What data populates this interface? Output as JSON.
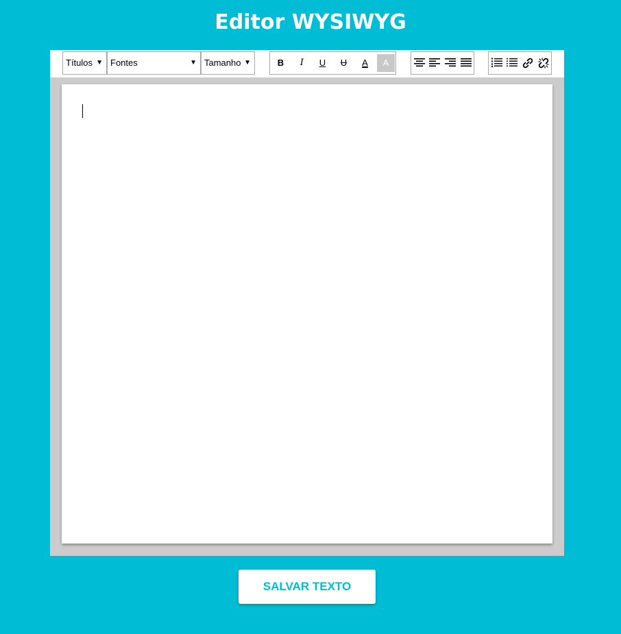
{
  "app": {
    "title": "Editor WYSIWYG"
  },
  "toolbar": {
    "headings_select": "Títulos",
    "fonts_select": "Fontes",
    "size_select": "Tamanho",
    "bold_label": "B",
    "italic_label": "I",
    "underline_label": "U",
    "strike_label": "U",
    "font_color_label": "A",
    "bg_color_label": "A",
    "icons": {
      "align_center": "align-center-icon",
      "align_left": "align-left-icon",
      "align_right": "align-right-icon",
      "justify": "align-justify-icon",
      "ordered_list": "ordered-list-icon",
      "unordered_list": "unordered-list-icon",
      "link": "link-icon",
      "unlink": "unlink-icon"
    }
  },
  "editor": {
    "content": ""
  },
  "actions": {
    "save_label": "SALVAR TEXTO"
  },
  "colors": {
    "background": "#00bcd4",
    "frame": "#cccccc",
    "accent_text": "#00bcd4",
    "active_button": "#c8c8c8"
  }
}
